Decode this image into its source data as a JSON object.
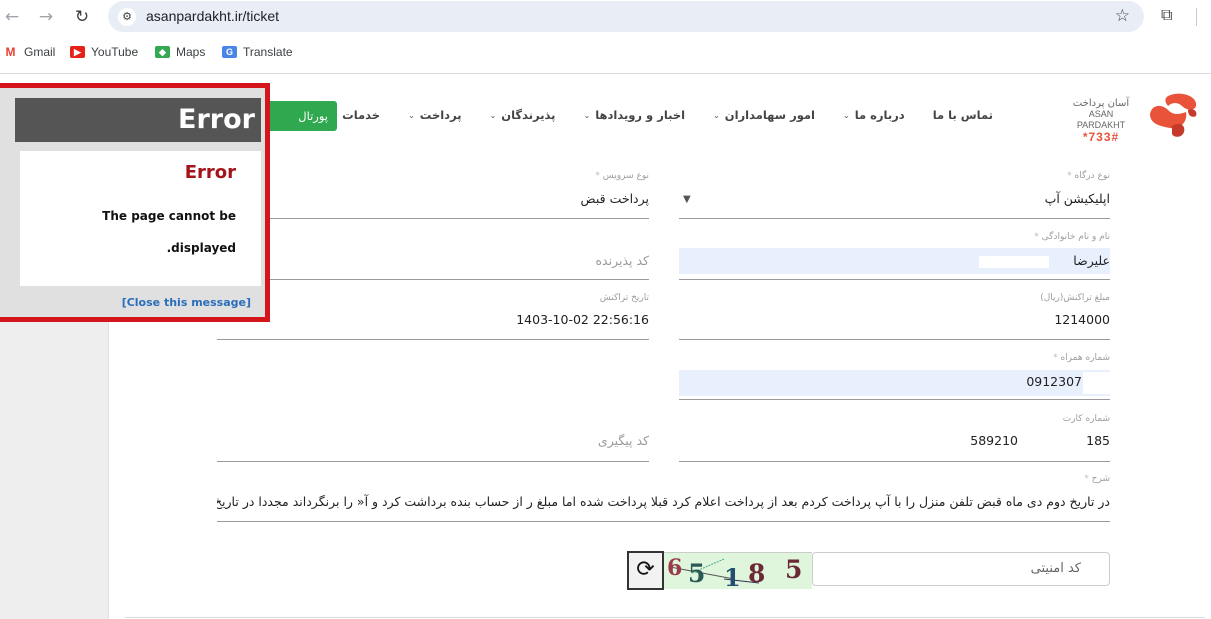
{
  "browser": {
    "url": "asanpardakht.ir/ticket",
    "back_icon": "←",
    "forward_icon": "→",
    "reload_icon": "↻",
    "site_info_icon": "⚙",
    "bookmark_star_icon": "☆",
    "extensions_icon": "⧉",
    "bookmarks": [
      {
        "label": "Gmail",
        "icon": "M",
        "color": "#ea4335"
      },
      {
        "label": "YouTube",
        "icon": "▶",
        "color": "#e62117"
      },
      {
        "label": "Maps",
        "icon": "◆",
        "color": "#34a853"
      },
      {
        "label": "Translate",
        "icon": "G",
        "color": "#4a86e8"
      }
    ]
  },
  "site": {
    "logo": {
      "fa": "آسان پرداخت",
      "en": "ASAN PARDAKHT",
      "code": "*733#",
      "brand_color": "#e8533a"
    },
    "nav": [
      {
        "label": "خدمات",
        "dropdown": true
      },
      {
        "label": "پرداخت",
        "dropdown": true
      },
      {
        "label": "پذیرندگان",
        "dropdown": true
      },
      {
        "label": "اخبار و رویدادها",
        "dropdown": true
      },
      {
        "label": "امور سهامداران",
        "dropdown": true
      },
      {
        "label": "درباره ما",
        "dropdown": true
      },
      {
        "label": "تماس با ما",
        "dropdown": false
      }
    ],
    "chevron": "⌄",
    "portal_button": "پورتال پذیرندگان"
  },
  "form": {
    "gateway_type": {
      "label": "نوع درگاه",
      "required": "*",
      "value": "اپلیکیشن آپ",
      "arrow": "▼"
    },
    "service_type": {
      "label": "نوع سرویس",
      "required": "*",
      "value": "پرداخت قبض"
    },
    "full_name": {
      "label": "نام و نام خانوادگی",
      "required": "*",
      "value": "علیرضا"
    },
    "merchant_code": {
      "placeholder": "کد پذیرنده"
    },
    "amount": {
      "label": "مبلغ تراکنش(ریال)",
      "value": "1214000"
    },
    "transaction_date": {
      "label": "تاریخ تراکنش",
      "value": "1403-10-02 22:56:16"
    },
    "mobile": {
      "label": "شماره همراه",
      "required": "*",
      "value": "0912307"
    },
    "card_number": {
      "label": "شماره کارت",
      "value_start": "589210",
      "value_end": "185"
    },
    "tracking_code": {
      "placeholder": "کد پیگیری"
    },
    "description": {
      "label": "شرح",
      "required": "*",
      "value": "در تاریخ دوم دی ماه قبض تلفن منزل را با آپ پرداخت کردم بعد از پرداخت اعلام کرد قبلا پرداخت شده اما مبلغ ر از حساب بنده برداشت کرد و آ« را برنگرداند مجددا در تاریخ یازدهم د"
    },
    "captcha": {
      "placeholder": "کد امنیتی",
      "digits": [
        "6",
        "5",
        "1",
        "8",
        "5"
      ],
      "refresh_icon": "⟳"
    }
  },
  "error_dialog": {
    "title": "Error",
    "heading": "Error",
    "message_line1": "The page cannot be",
    "message_line2": ".displayed",
    "close_link": "[Close this message]",
    "border_color": "#d4151b"
  }
}
